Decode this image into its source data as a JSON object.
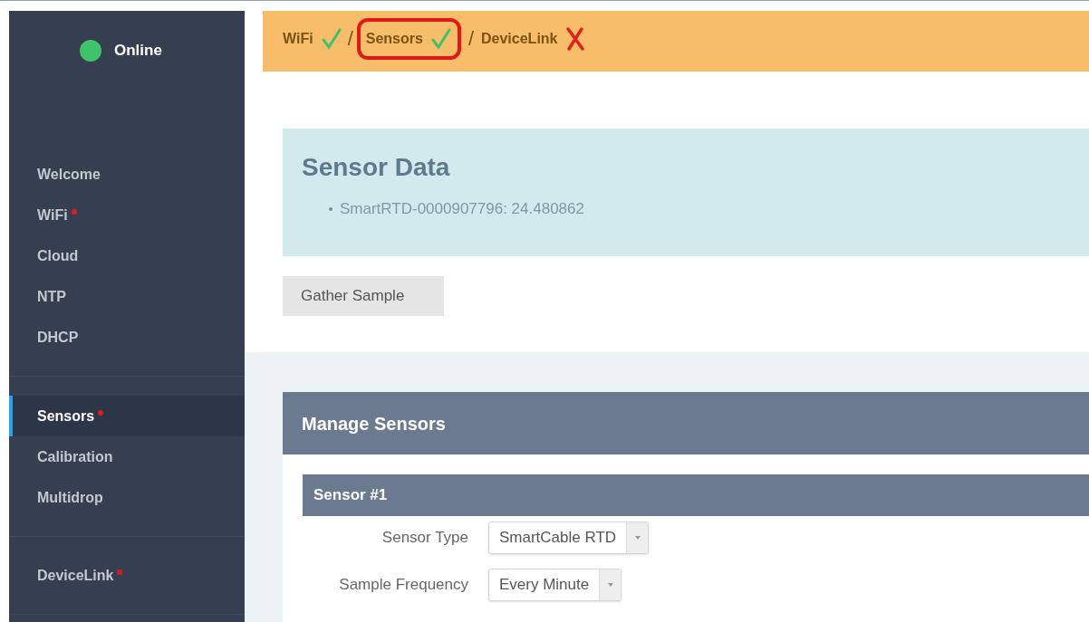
{
  "status": {
    "label": "Online",
    "online": true
  },
  "steps": [
    {
      "label": "WiFi",
      "ok": true,
      "highlighted": false
    },
    {
      "separator": "/",
      "label": "Sensors",
      "ok": true,
      "highlighted": true
    },
    {
      "separator": "/",
      "label": "DeviceLink",
      "ok": false,
      "highlighted": false
    }
  ],
  "sidebar": {
    "groups": [
      [
        {
          "label": "Welcome",
          "required": false,
          "selected": false
        },
        {
          "label": "WiFi",
          "required": true,
          "selected": false
        },
        {
          "label": "Cloud",
          "required": false,
          "selected": false
        },
        {
          "label": "NTP",
          "required": false,
          "selected": false
        },
        {
          "label": "DHCP",
          "required": false,
          "selected": false
        }
      ],
      [
        {
          "label": "Sensors",
          "required": true,
          "selected": true
        },
        {
          "label": "Calibration",
          "required": false,
          "selected": false
        },
        {
          "label": "Multidrop",
          "required": false,
          "selected": false
        }
      ],
      [
        {
          "label": "DeviceLink",
          "required": true,
          "selected": false
        }
      ]
    ]
  },
  "sensor_data": {
    "title": "Sensor Data",
    "readings": [
      "SmartRTD-0000907796: 24.480862"
    ]
  },
  "gather_button": "Gather Sample",
  "manage": {
    "title": "Manage Sensors",
    "sensors": [
      {
        "title": "Sensor #1",
        "fields": [
          {
            "label": "Sensor Type",
            "value": "SmartCable RTD"
          },
          {
            "label": "Sample Frequency",
            "value": "Every Minute"
          }
        ]
      }
    ]
  }
}
